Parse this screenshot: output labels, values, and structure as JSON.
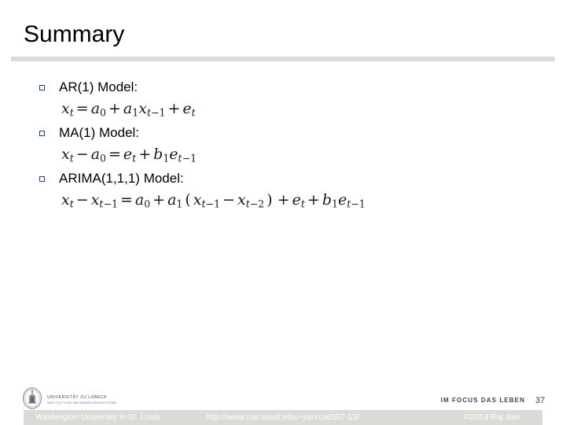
{
  "slide": {
    "title": "Summary",
    "number": "37"
  },
  "bullets": [
    {
      "label": "AR(1) Model:",
      "marker": "hollow-square-bullet"
    },
    {
      "label": "MA(1) Model:",
      "marker": "hollow-square-bullet"
    },
    {
      "label": "ARIMA(1,1,1) Model:",
      "marker": "hollow-square-bullet"
    }
  ],
  "equations": {
    "ar1": {
      "plain": "x_t = a_0 + a_1 x_{t-1} + e_t"
    },
    "ma1": {
      "plain": "x_t - a_0 = e_t + b_1 e_{t-1}"
    },
    "arima": {
      "plain": "x_t - x_{t-1} = a_0 + a_1 ( x_{t-1} - x_{t-2} ) + e_t + b_1 e_{t-1}"
    },
    "symbols": {
      "x": "x",
      "a": "a",
      "b": "b",
      "e": "e",
      "t": "t",
      "equals": "=",
      "plus": "+",
      "minus": "−",
      "lparen": "(",
      "rparen": ")",
      "zero": "0",
      "one": "1",
      "two": "2",
      "sub_t": "t",
      "sub_t_minus_1": "t−1",
      "sub_t_minus_2": "t−2"
    }
  },
  "footer": {
    "logo": {
      "line1": "UNIVERSITÄT ZU LÜBECK",
      "line2": "INSTITUT FÜR INFORMATIONSSYSTEME",
      "seal_name": "university-seal-icon"
    },
    "tagline": "IM FOCUS DAS LEBEN",
    "organization": "Washington University in St. Louis",
    "url": "http://www.cse.wustl.edu/~jain/cse567-13/",
    "copyright": "©2013 Raj Jain"
  },
  "colors": {
    "divider": "#dcdcd6",
    "bullet_outline": "#2a3f6b",
    "footer_bar": "#d9dbd6",
    "footer_text": "#ffffff",
    "title_text": "#000000",
    "tagline_text": "#3b444f"
  }
}
